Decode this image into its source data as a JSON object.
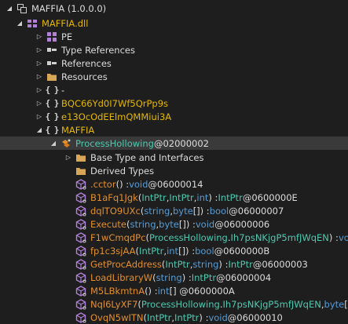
{
  "tree": {
    "assembly": {
      "label": "MAFFIA (1.0.0.0)"
    },
    "module": {
      "label": "MAFFIA.dll"
    },
    "module_children": [
      {
        "label": "PE"
      },
      {
        "label": "Type References"
      },
      {
        "label": "References"
      },
      {
        "label": "Resources"
      }
    ],
    "namespaces": [
      {
        "label": "-"
      },
      {
        "label": "BQC66Yd0I7Wf5QrPp9s"
      },
      {
        "label": "e13OcOdEElmQMMiui3A"
      },
      {
        "label": "MAFFIA"
      }
    ],
    "class": {
      "name": "ProcessHollowing",
      "token": " @02000002"
    },
    "class_children": [
      {
        "label": "Base Type and Interfaces"
      },
      {
        "label": "Derived Types"
      }
    ],
    "members": [
      {
        "parts": [
          {
            "t": ".cctor",
            "c": "c-orange"
          },
          {
            "t": "() : ",
            "c": "c-white"
          },
          {
            "t": "void",
            "c": "c-blue"
          },
          {
            "t": " @06000014",
            "c": "c-white"
          }
        ]
      },
      {
        "parts": [
          {
            "t": "B1aFq1Jgk",
            "c": "c-orange"
          },
          {
            "t": "(",
            "c": "c-white"
          },
          {
            "t": "IntPtr",
            "c": "c-teal"
          },
          {
            "t": ", ",
            "c": "c-white"
          },
          {
            "t": "IntPtr",
            "c": "c-teal"
          },
          {
            "t": ", ",
            "c": "c-white"
          },
          {
            "t": "int",
            "c": "c-blue"
          },
          {
            "t": ") : ",
            "c": "c-white"
          },
          {
            "t": "IntPtr",
            "c": "c-teal"
          },
          {
            "t": " @0600000E",
            "c": "c-white"
          }
        ]
      },
      {
        "parts": [
          {
            "t": "dqlTO9UXc",
            "c": "c-orange"
          },
          {
            "t": "(",
            "c": "c-white"
          },
          {
            "t": "string",
            "c": "c-blue"
          },
          {
            "t": ", ",
            "c": "c-white"
          },
          {
            "t": "byte",
            "c": "c-blue"
          },
          {
            "t": "[]) : ",
            "c": "c-white"
          },
          {
            "t": "bool",
            "c": "c-blue"
          },
          {
            "t": " @06000007",
            "c": "c-white"
          }
        ]
      },
      {
        "parts": [
          {
            "t": "Execute",
            "c": "c-orange"
          },
          {
            "t": "(",
            "c": "c-white"
          },
          {
            "t": "string",
            "c": "c-blue"
          },
          {
            "t": ", ",
            "c": "c-white"
          },
          {
            "t": "byte",
            "c": "c-blue"
          },
          {
            "t": "[]) : ",
            "c": "c-white"
          },
          {
            "t": "void",
            "c": "c-blue"
          },
          {
            "t": " @06000006",
            "c": "c-white"
          }
        ]
      },
      {
        "parts": [
          {
            "t": "F1wCmqdPc",
            "c": "c-orange"
          },
          {
            "t": "(",
            "c": "c-white"
          },
          {
            "t": "ProcessHollowing",
            "c": "c-teal"
          },
          {
            "t": ".",
            "c": "c-white"
          },
          {
            "t": "Ih7psNKjgP5mfJWqEN",
            "c": "c-teal"
          },
          {
            "t": ") : ",
            "c": "c-white"
          },
          {
            "t": "void",
            "c": "c-blue"
          }
        ]
      },
      {
        "parts": [
          {
            "t": "fp1c3sjAA",
            "c": "c-orange"
          },
          {
            "t": "(",
            "c": "c-white"
          },
          {
            "t": "IntPtr",
            "c": "c-teal"
          },
          {
            "t": ", ",
            "c": "c-white"
          },
          {
            "t": "int",
            "c": "c-blue"
          },
          {
            "t": "[]) : ",
            "c": "c-white"
          },
          {
            "t": "bool",
            "c": "c-blue"
          },
          {
            "t": " @0600000B",
            "c": "c-white"
          }
        ]
      },
      {
        "parts": [
          {
            "t": "GetProcAddress",
            "c": "c-orange"
          },
          {
            "t": "(",
            "c": "c-white"
          },
          {
            "t": "IntPtr",
            "c": "c-teal"
          },
          {
            "t": ", ",
            "c": "c-white"
          },
          {
            "t": "string",
            "c": "c-blue"
          },
          {
            "t": ") : ",
            "c": "c-white"
          },
          {
            "t": "IntPtr",
            "c": "c-teal"
          },
          {
            "t": " @06000003",
            "c": "c-white"
          }
        ]
      },
      {
        "parts": [
          {
            "t": "LoadLibraryW",
            "c": "c-orange"
          },
          {
            "t": "(",
            "c": "c-white"
          },
          {
            "t": "string",
            "c": "c-blue"
          },
          {
            "t": ") : ",
            "c": "c-white"
          },
          {
            "t": "IntPtr",
            "c": "c-teal"
          },
          {
            "t": " @06000004",
            "c": "c-white"
          }
        ]
      },
      {
        "parts": [
          {
            "t": "M5LBkmtnA",
            "c": "c-orange"
          },
          {
            "t": "() : ",
            "c": "c-white"
          },
          {
            "t": "int",
            "c": "c-blue"
          },
          {
            "t": "[] @0600000A",
            "c": "c-white"
          }
        ]
      },
      {
        "parts": [
          {
            "t": "Nql6LyXF7",
            "c": "c-orange"
          },
          {
            "t": "(",
            "c": "c-white"
          },
          {
            "t": "ProcessHollowing",
            "c": "c-teal"
          },
          {
            "t": ".",
            "c": "c-white"
          },
          {
            "t": "Ih7psNKjgP5mfJWqEN",
            "c": "c-teal"
          },
          {
            "t": ", ",
            "c": "c-white"
          },
          {
            "t": "byte",
            "c": "c-blue"
          },
          {
            "t": "[],",
            "c": "c-white"
          }
        ]
      },
      {
        "parts": [
          {
            "t": "OvqN5wITN",
            "c": "c-orange"
          },
          {
            "t": "(",
            "c": "c-white"
          },
          {
            "t": "IntPtr",
            "c": "c-teal"
          },
          {
            "t": ", ",
            "c": "c-white"
          },
          {
            "t": "IntPtr",
            "c": "c-teal"
          },
          {
            "t": ") : ",
            "c": "c-white"
          },
          {
            "t": "void",
            "c": "c-blue"
          },
          {
            "t": " @06000010",
            "c": "c-white"
          }
        ]
      }
    ]
  }
}
